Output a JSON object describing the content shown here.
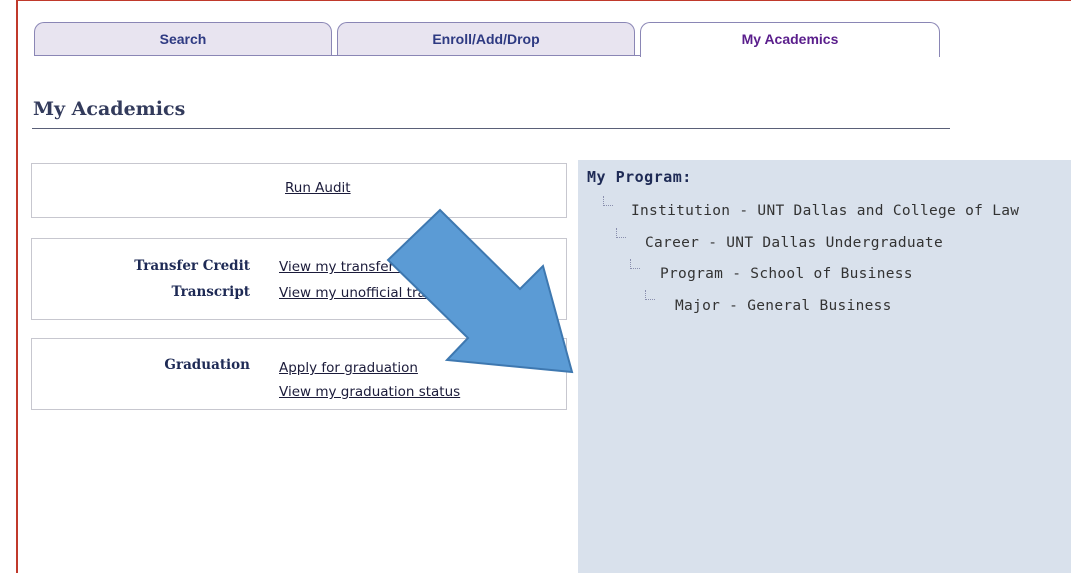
{
  "tabs": [
    {
      "label": "Search",
      "active": false
    },
    {
      "label": "Enroll/Add/Drop",
      "active": false
    },
    {
      "label": "My Academics",
      "active": true
    }
  ],
  "page_title": "My Academics",
  "audit": {
    "run_audit_link": "Run Audit"
  },
  "records": {
    "transfer_credit_label": "Transfer Credit",
    "transfer_credit_link": "View my transfer credit",
    "transcript_label": "Transcript",
    "transcript_link": "View my unofficial transcript"
  },
  "graduation": {
    "label": "Graduation",
    "apply_link": "Apply for graduation",
    "status_link": "View my graduation status"
  },
  "program": {
    "heading": "My Program:",
    "tree": [
      "Institution - UNT Dallas and College of Law",
      "Career - UNT Dallas Undergraduate",
      "Program - School of Business",
      "Major - General Business"
    ]
  },
  "annotation": {
    "arrow_color": "#5b9bd5",
    "arrow_icon": "arrow-down-left-icon"
  },
  "colors": {
    "tab_active_text": "#5a1e8c",
    "tab_text": "#2e3a82",
    "panel_bg": "#d9e1ec"
  }
}
